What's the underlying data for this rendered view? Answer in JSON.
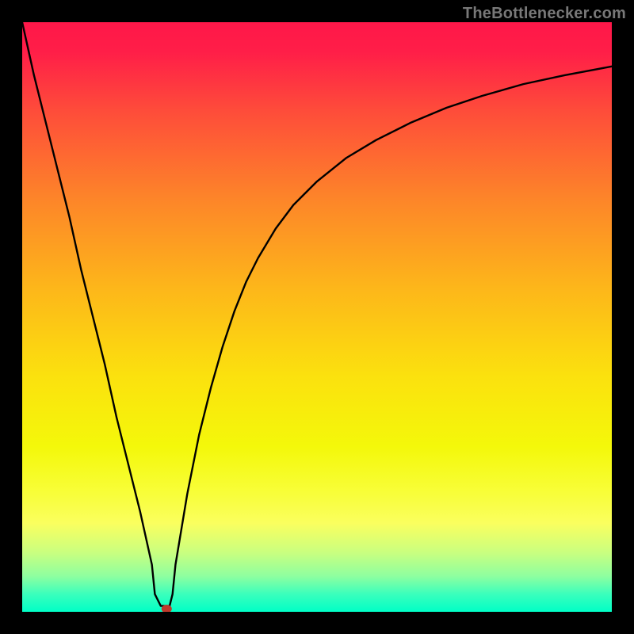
{
  "attribution": "TheBottlenecker.com",
  "chart_data": {
    "type": "line",
    "title": "",
    "xlabel": "",
    "ylabel": "",
    "xlim": [
      0,
      100
    ],
    "ylim": [
      0,
      100
    ],
    "background_gradient": {
      "stops": [
        {
          "pct": 0,
          "color": "#ff1749"
        },
        {
          "pct": 5,
          "color": "#ff1e48"
        },
        {
          "pct": 15,
          "color": "#fe4c3a"
        },
        {
          "pct": 30,
          "color": "#fd8529"
        },
        {
          "pct": 45,
          "color": "#fdb61a"
        },
        {
          "pct": 60,
          "color": "#fbe10e"
        },
        {
          "pct": 72,
          "color": "#f4f80a"
        },
        {
          "pct": 80,
          "color": "#f8fe3a"
        },
        {
          "pct": 85,
          "color": "#faff5f"
        },
        {
          "pct": 90,
          "color": "#c9ff80"
        },
        {
          "pct": 94,
          "color": "#8dffa0"
        },
        {
          "pct": 97,
          "color": "#3affbc"
        },
        {
          "pct": 100,
          "color": "#00ffc6"
        }
      ]
    },
    "marker": {
      "x": 24.5,
      "y": 0.5,
      "color": "#c0392b"
    },
    "series": [
      {
        "name": "curve",
        "x": [
          0,
          2,
          4,
          6,
          8,
          10,
          12,
          14,
          16,
          18,
          20,
          22,
          22.5,
          23.5,
          25,
          25.5,
          26,
          28,
          30,
          32,
          34,
          36,
          38,
          40,
          43,
          46,
          50,
          55,
          60,
          66,
          72,
          78,
          85,
          92,
          100
        ],
        "y": [
          100,
          91,
          83,
          75,
          67,
          58,
          50,
          42,
          33,
          25,
          17,
          8,
          3,
          1,
          1,
          3,
          8,
          20,
          30,
          38,
          45,
          51,
          56,
          60,
          65,
          69,
          73,
          77,
          80,
          83,
          85.5,
          87.5,
          89.5,
          91,
          92.5
        ]
      }
    ]
  }
}
